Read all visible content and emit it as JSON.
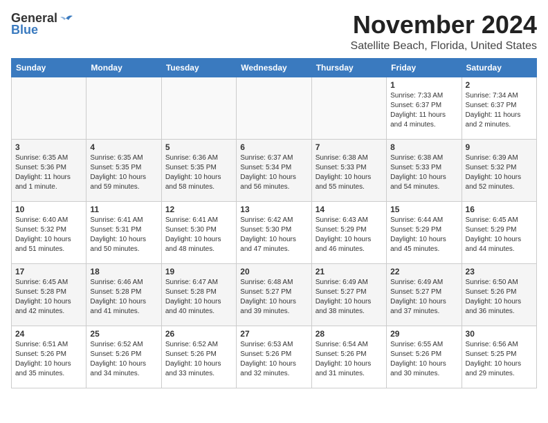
{
  "header": {
    "logo_general": "General",
    "logo_blue": "Blue",
    "month_title": "November 2024",
    "location": "Satellite Beach, Florida, United States"
  },
  "days_of_week": [
    "Sunday",
    "Monday",
    "Tuesday",
    "Wednesday",
    "Thursday",
    "Friday",
    "Saturday"
  ],
  "weeks": [
    [
      {
        "day": "",
        "content": ""
      },
      {
        "day": "",
        "content": ""
      },
      {
        "day": "",
        "content": ""
      },
      {
        "day": "",
        "content": ""
      },
      {
        "day": "",
        "content": ""
      },
      {
        "day": "1",
        "content": "Sunrise: 7:33 AM\nSunset: 6:37 PM\nDaylight: 11 hours\nand 4 minutes."
      },
      {
        "day": "2",
        "content": "Sunrise: 7:34 AM\nSunset: 6:37 PM\nDaylight: 11 hours\nand 2 minutes."
      }
    ],
    [
      {
        "day": "3",
        "content": "Sunrise: 6:35 AM\nSunset: 5:36 PM\nDaylight: 11 hours\nand 1 minute."
      },
      {
        "day": "4",
        "content": "Sunrise: 6:35 AM\nSunset: 5:35 PM\nDaylight: 10 hours\nand 59 minutes."
      },
      {
        "day": "5",
        "content": "Sunrise: 6:36 AM\nSunset: 5:35 PM\nDaylight: 10 hours\nand 58 minutes."
      },
      {
        "day": "6",
        "content": "Sunrise: 6:37 AM\nSunset: 5:34 PM\nDaylight: 10 hours\nand 56 minutes."
      },
      {
        "day": "7",
        "content": "Sunrise: 6:38 AM\nSunset: 5:33 PM\nDaylight: 10 hours\nand 55 minutes."
      },
      {
        "day": "8",
        "content": "Sunrise: 6:38 AM\nSunset: 5:33 PM\nDaylight: 10 hours\nand 54 minutes."
      },
      {
        "day": "9",
        "content": "Sunrise: 6:39 AM\nSunset: 5:32 PM\nDaylight: 10 hours\nand 52 minutes."
      }
    ],
    [
      {
        "day": "10",
        "content": "Sunrise: 6:40 AM\nSunset: 5:32 PM\nDaylight: 10 hours\nand 51 minutes."
      },
      {
        "day": "11",
        "content": "Sunrise: 6:41 AM\nSunset: 5:31 PM\nDaylight: 10 hours\nand 50 minutes."
      },
      {
        "day": "12",
        "content": "Sunrise: 6:41 AM\nSunset: 5:30 PM\nDaylight: 10 hours\nand 48 minutes."
      },
      {
        "day": "13",
        "content": "Sunrise: 6:42 AM\nSunset: 5:30 PM\nDaylight: 10 hours\nand 47 minutes."
      },
      {
        "day": "14",
        "content": "Sunrise: 6:43 AM\nSunset: 5:29 PM\nDaylight: 10 hours\nand 46 minutes."
      },
      {
        "day": "15",
        "content": "Sunrise: 6:44 AM\nSunset: 5:29 PM\nDaylight: 10 hours\nand 45 minutes."
      },
      {
        "day": "16",
        "content": "Sunrise: 6:45 AM\nSunset: 5:29 PM\nDaylight: 10 hours\nand 44 minutes."
      }
    ],
    [
      {
        "day": "17",
        "content": "Sunrise: 6:45 AM\nSunset: 5:28 PM\nDaylight: 10 hours\nand 42 minutes."
      },
      {
        "day": "18",
        "content": "Sunrise: 6:46 AM\nSunset: 5:28 PM\nDaylight: 10 hours\nand 41 minutes."
      },
      {
        "day": "19",
        "content": "Sunrise: 6:47 AM\nSunset: 5:28 PM\nDaylight: 10 hours\nand 40 minutes."
      },
      {
        "day": "20",
        "content": "Sunrise: 6:48 AM\nSunset: 5:27 PM\nDaylight: 10 hours\nand 39 minutes."
      },
      {
        "day": "21",
        "content": "Sunrise: 6:49 AM\nSunset: 5:27 PM\nDaylight: 10 hours\nand 38 minutes."
      },
      {
        "day": "22",
        "content": "Sunrise: 6:49 AM\nSunset: 5:27 PM\nDaylight: 10 hours\nand 37 minutes."
      },
      {
        "day": "23",
        "content": "Sunrise: 6:50 AM\nSunset: 5:26 PM\nDaylight: 10 hours\nand 36 minutes."
      }
    ],
    [
      {
        "day": "24",
        "content": "Sunrise: 6:51 AM\nSunset: 5:26 PM\nDaylight: 10 hours\nand 35 minutes."
      },
      {
        "day": "25",
        "content": "Sunrise: 6:52 AM\nSunset: 5:26 PM\nDaylight: 10 hours\nand 34 minutes."
      },
      {
        "day": "26",
        "content": "Sunrise: 6:52 AM\nSunset: 5:26 PM\nDaylight: 10 hours\nand 33 minutes."
      },
      {
        "day": "27",
        "content": "Sunrise: 6:53 AM\nSunset: 5:26 PM\nDaylight: 10 hours\nand 32 minutes."
      },
      {
        "day": "28",
        "content": "Sunrise: 6:54 AM\nSunset: 5:26 PM\nDaylight: 10 hours\nand 31 minutes."
      },
      {
        "day": "29",
        "content": "Sunrise: 6:55 AM\nSunset: 5:26 PM\nDaylight: 10 hours\nand 30 minutes."
      },
      {
        "day": "30",
        "content": "Sunrise: 6:56 AM\nSunset: 5:25 PM\nDaylight: 10 hours\nand 29 minutes."
      }
    ]
  ]
}
